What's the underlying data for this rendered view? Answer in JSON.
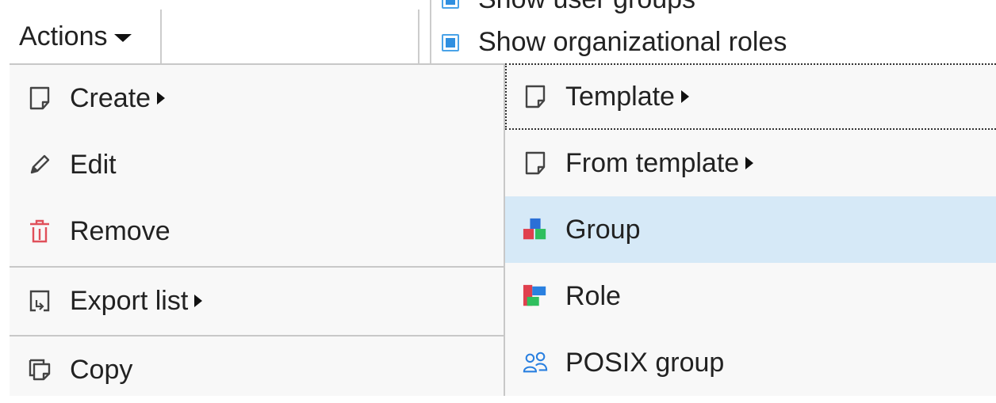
{
  "toolbar": {
    "actions_label": "Actions",
    "show_user_groups": "Show user groups",
    "show_org_roles": "Show organizational roles"
  },
  "menu": {
    "create": "Create",
    "edit": "Edit",
    "remove": "Remove",
    "export_list": "Export list",
    "copy": "Copy"
  },
  "submenu": {
    "template": "Template",
    "from_template": "From template",
    "group": "Group",
    "role": "Role",
    "posix_group": "POSIX group"
  },
  "icons": {
    "create": "new-document-icon",
    "edit": "pencil-icon",
    "remove": "trash-icon",
    "export": "export-icon",
    "copy": "copy-icon",
    "template": "new-document-icon",
    "from_template": "new-document-icon",
    "group": "group-blocks-icon",
    "role": "role-blocks-icon",
    "posix_group": "users-icon"
  },
  "colors": {
    "highlight": "#d6e9f7",
    "checkbox": "#2f8fe0",
    "trash": "#e0505a"
  }
}
